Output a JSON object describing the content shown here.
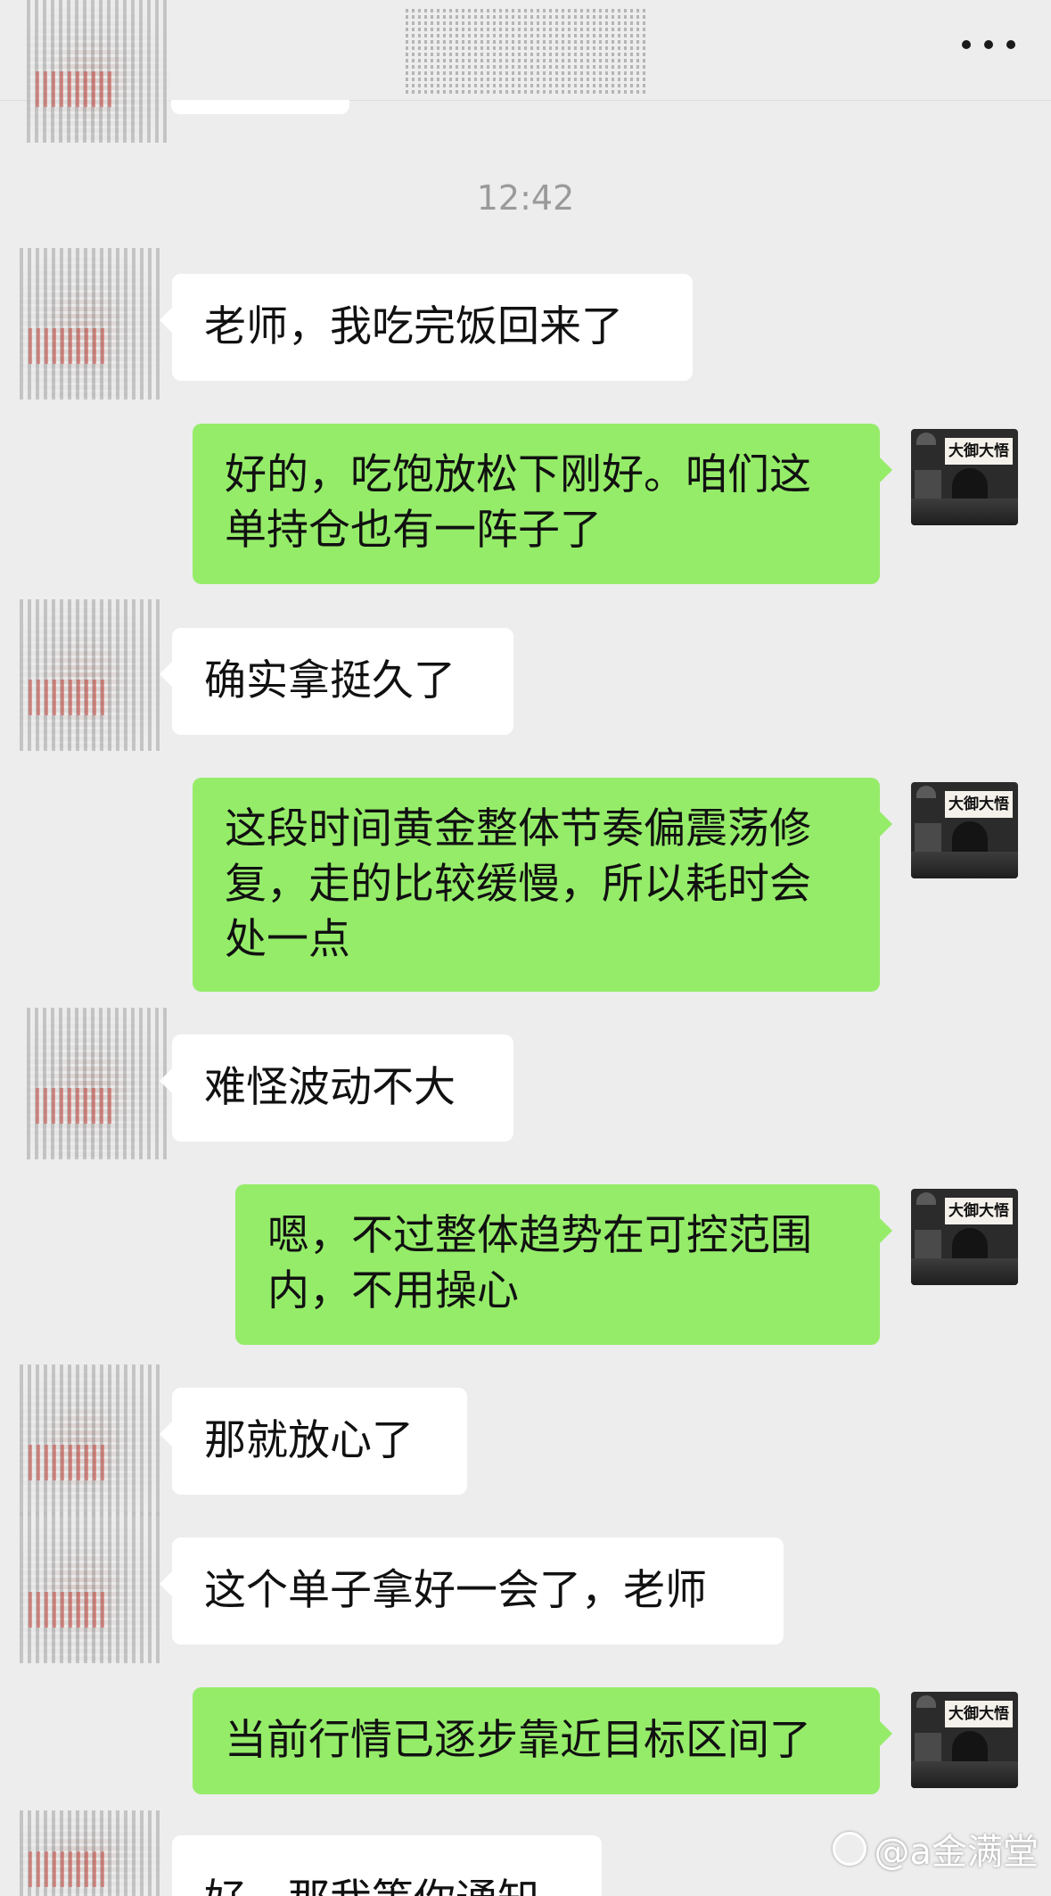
{
  "header": {
    "more_icon": "more-dots-icon"
  },
  "timestamp": "12:42",
  "teacher_avatar_sign": "大御大悟",
  "messages": [
    {
      "side": "left",
      "text": "老师，我吃完饭回来了"
    },
    {
      "side": "right",
      "text": "好的，吃饱放松下刚好。咱们这单持仓也有一阵子了"
    },
    {
      "side": "left",
      "text": "确实拿挺久了"
    },
    {
      "side": "right",
      "text": "这段时间黄金整体节奏偏震荡修复，走的比较缓慢，所以耗时会处一点"
    },
    {
      "side": "left",
      "text": "难怪波动不大"
    },
    {
      "side": "right",
      "text": "嗯，不过整体趋势在可控范围内，不用操心"
    },
    {
      "side": "left",
      "text": "那就放心了"
    },
    {
      "side": "left",
      "text": "这个单子拿好一会了，老师"
    },
    {
      "side": "right",
      "text": "当前行情已逐步靠近目标区间了"
    },
    {
      "side": "left",
      "text": "好，那我等你通知"
    }
  ],
  "watermark": "@a金满堂"
}
